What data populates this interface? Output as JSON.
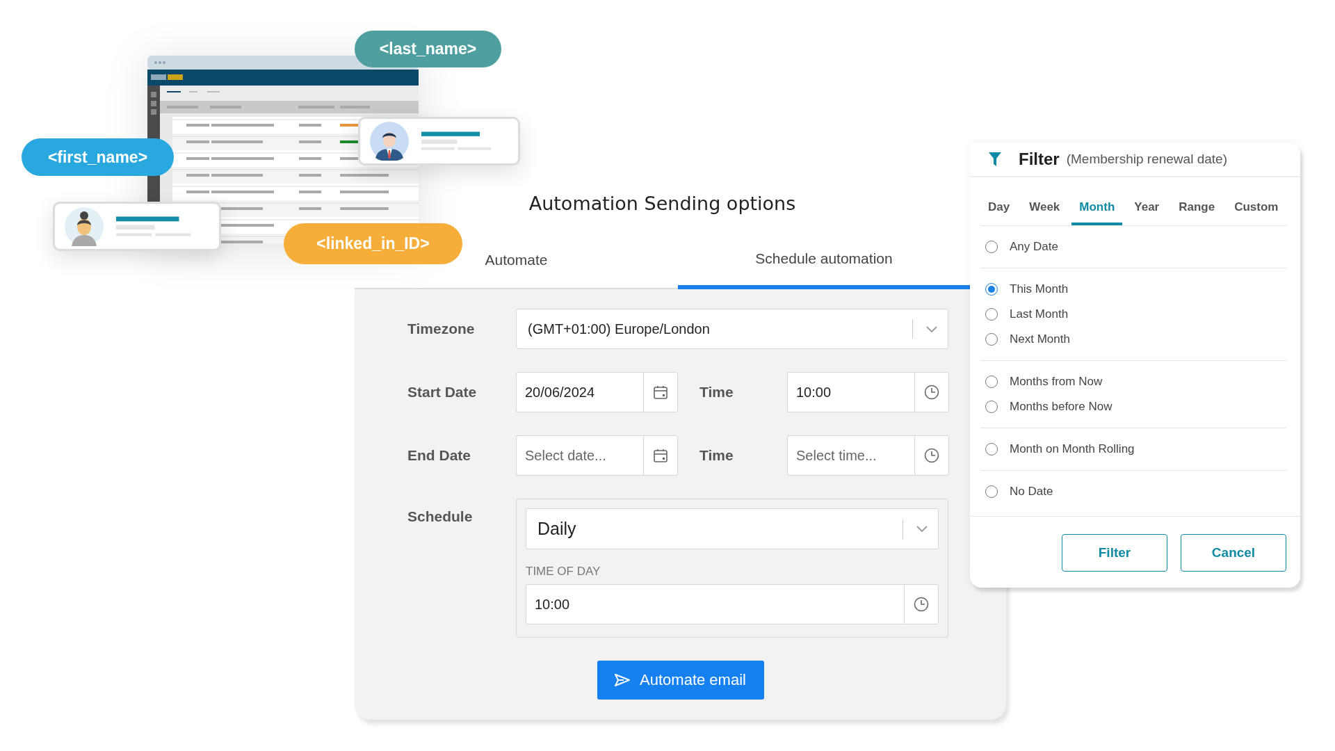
{
  "tags": [
    {
      "text": "<last_name>",
      "color": "#4f9ea0"
    },
    {
      "text": "<first_name>",
      "color": "#29a8e0"
    },
    {
      "text": "<linked_in_ID>",
      "color": "#f7ad3a"
    }
  ],
  "automation": {
    "title": "Automation Sending options",
    "tabs": [
      {
        "label": "Automate",
        "selected": false
      },
      {
        "label": "Schedule automation",
        "selected": true
      }
    ],
    "timezone": {
      "label": "Timezone",
      "value": "(GMT+01:00) Europe/London"
    },
    "start": {
      "label": "Start Date",
      "date_value": "20/06/2024",
      "time_label": "Time",
      "time_value": "10:00"
    },
    "end": {
      "label": "End Date",
      "date_placeholder": "Select date...",
      "time_label": "Time",
      "time_placeholder": "Select time..."
    },
    "schedule": {
      "label": "Schedule",
      "value": "Daily",
      "time_of_day_label": "TIME OF DAY",
      "time_of_day_value": "10:00"
    },
    "button": "Automate email"
  },
  "filter": {
    "title": "Filter",
    "subtitle": "(Membership renewal date)",
    "tabs": [
      {
        "label": "Day",
        "selected": false
      },
      {
        "label": "Week",
        "selected": false
      },
      {
        "label": "Month",
        "selected": true
      },
      {
        "label": "Year",
        "selected": false
      },
      {
        "label": "Range",
        "selected": false
      },
      {
        "label": "Custom",
        "selected": false
      }
    ],
    "option_groups": [
      {
        "options": [
          {
            "label": "Any Date",
            "selected": false
          }
        ]
      },
      {
        "options": [
          {
            "label": "This Month",
            "selected": true
          },
          {
            "label": "Last Month",
            "selected": false
          },
          {
            "label": "Next Month",
            "selected": false
          }
        ]
      },
      {
        "options": [
          {
            "label": "Months from Now",
            "selected": false
          },
          {
            "label": "Months before Now",
            "selected": false
          }
        ]
      },
      {
        "options": [
          {
            "label": "Month on Month Rolling",
            "selected": false
          }
        ]
      },
      {
        "options": [
          {
            "label": "No Date",
            "selected": false
          }
        ]
      }
    ],
    "buttons": [
      "Filter",
      "Cancel"
    ]
  }
}
